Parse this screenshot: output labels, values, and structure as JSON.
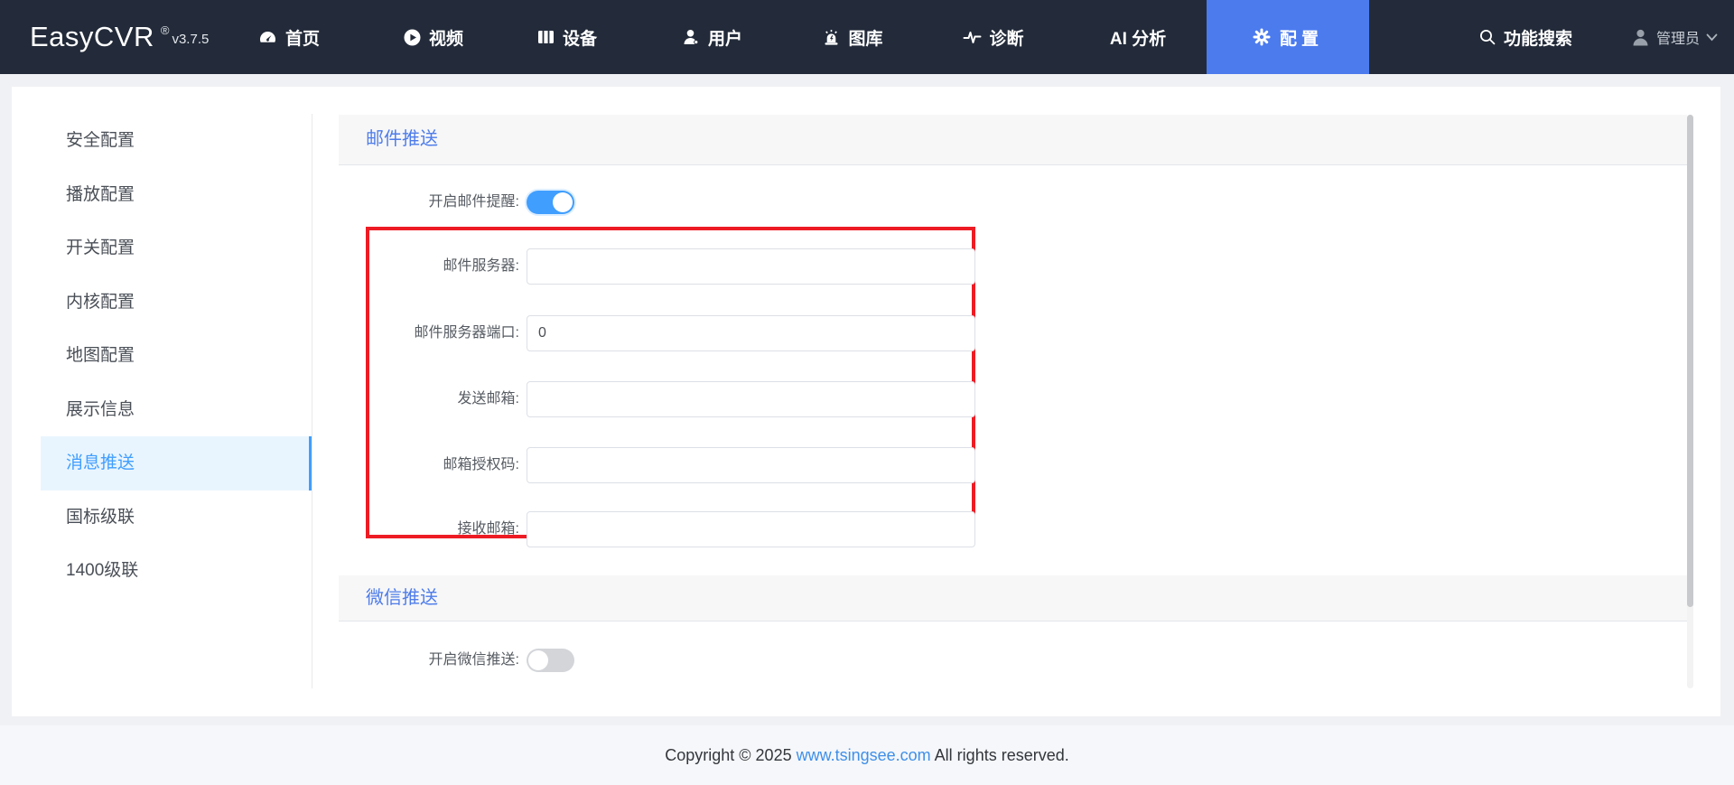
{
  "navbar": {
    "logo": "EasyCVR",
    "reg": "®",
    "version": "v3.7.5",
    "items": [
      {
        "label": "首页",
        "icon": "gauge-icon"
      },
      {
        "label": "视频",
        "icon": "play-icon"
      },
      {
        "label": "设备",
        "icon": "device-icon"
      },
      {
        "label": "用户",
        "icon": "user-icon"
      },
      {
        "label": "图库",
        "icon": "siren-icon"
      },
      {
        "label": "诊断",
        "icon": "pulse-icon"
      },
      {
        "label": "AI 分析",
        "icon": ""
      },
      {
        "label": "配置",
        "icon": "gear-icon",
        "active": true
      }
    ],
    "search_label": "功能搜索",
    "user_label": "管理员"
  },
  "sidebar": {
    "active_index": 6,
    "items": [
      {
        "label": "安全配置"
      },
      {
        "label": "播放配置"
      },
      {
        "label": "开关配置"
      },
      {
        "label": "内核配置"
      },
      {
        "label": "地图配置"
      },
      {
        "label": "展示信息"
      },
      {
        "label": "消息推送"
      },
      {
        "label": "国标级联"
      },
      {
        "label": "1400级联"
      }
    ]
  },
  "sections": [
    {
      "title": "邮件推送",
      "toggle": {
        "label": "开启邮件提醒:",
        "state": "on"
      },
      "fields": [
        {
          "label": "邮件服务器:",
          "value": ""
        },
        {
          "label": "邮件服务器端口:",
          "value": "0"
        },
        {
          "label": "发送邮箱:",
          "value": ""
        },
        {
          "label": "邮箱授权码:",
          "value": ""
        },
        {
          "label": "接收邮箱:",
          "value": ""
        }
      ],
      "highlight_box_color": "#ed1c24"
    },
    {
      "title": "微信推送",
      "toggle": {
        "label": "开启微信推送:",
        "state": "off"
      }
    }
  ],
  "footer": {
    "pre": "Copyright © 2025 ",
    "link": "www.tsingsee.com",
    "post": " All rights reserved."
  },
  "colors": {
    "navbar_bg": "#232b3a",
    "active_tab": "#4c7bee",
    "accent_blue": "#409eff",
    "title_blue": "#4e7ce9",
    "highlight_red": "#ed1c24",
    "link_blue": "#3f8fe8"
  }
}
